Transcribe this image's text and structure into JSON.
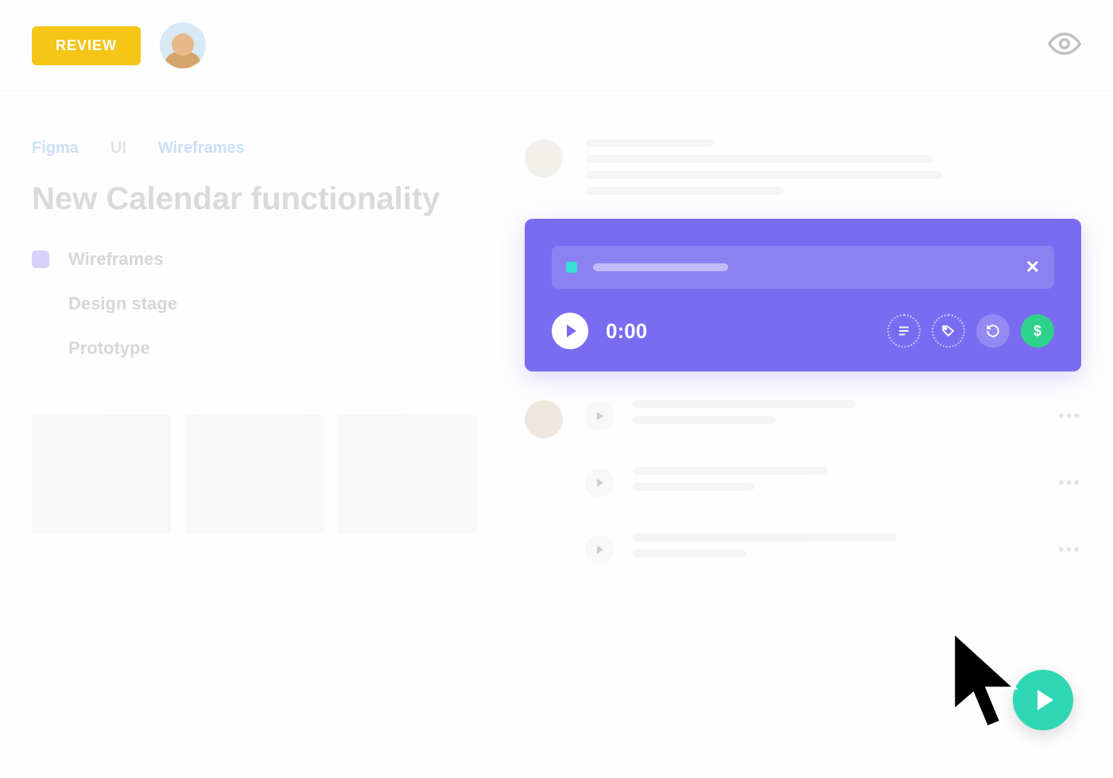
{
  "header": {
    "review_label": "REVIEW"
  },
  "breadcrumbs": [
    {
      "label": "Figma",
      "active": true
    },
    {
      "label": "UI",
      "active": false
    },
    {
      "label": "Wireframes",
      "active": true
    }
  ],
  "page_title": "New Calendar functionality",
  "stages": [
    {
      "label": "Wireframes",
      "selected": true
    },
    {
      "label": "Design stage",
      "selected": false
    },
    {
      "label": "Prototype",
      "selected": false
    }
  ],
  "recorder": {
    "timer": "0:00",
    "close_glyph": "✕",
    "actions": {
      "notes_glyph": "≣",
      "tag_glyph": "⌂",
      "history_glyph": "↺",
      "billable_glyph": "$"
    }
  },
  "feed_more_glyph": "•••",
  "colors": {
    "accent_purple": "#7a6cf0",
    "accent_green": "#2fd28a",
    "accent_teal": "#2fd6b3",
    "review_yellow": "#f5c518"
  }
}
